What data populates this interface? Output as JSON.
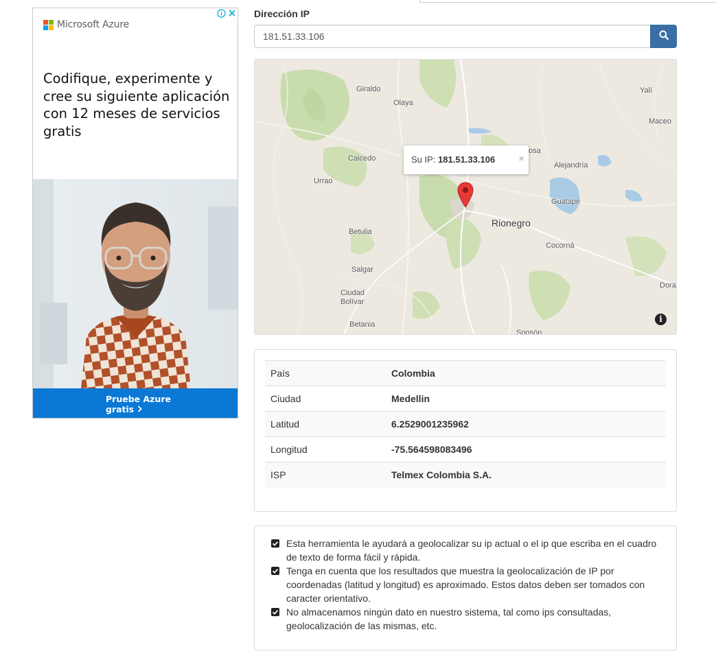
{
  "ad": {
    "brand": "Microsoft Azure",
    "headline": "Codifique, experimente y cree su siguiente aplicación con 12 meses de servicios gratis",
    "cta_line1": "Pruebe Azure",
    "cta_line2": "gratis",
    "info_icon": "info-icon",
    "close_icon": "close-icon",
    "colors": {
      "red": "#f25022",
      "green": "#7fba00",
      "blue": "#00a4ef",
      "yellow": "#ffb900",
      "cta": "#0a78d4"
    }
  },
  "search": {
    "label": "Dirección IP",
    "value": "181.51.33.106",
    "button_icon": "search-icon",
    "button_color": "#3b6ea5"
  },
  "map": {
    "popup_prefix": "Su IP:",
    "popup_ip": "181.51.33.106",
    "popup_close": "×",
    "info_symbol": "i",
    "places": [
      "Giraldo",
      "Olaya",
      "Yalí",
      "Maceo",
      "Caicedo",
      "Urrao",
      "Alejandría",
      "Guatapé",
      "Rionegro",
      "Betulia",
      "Cocorná",
      "Salgar",
      "Ciudad Bolívar",
      "Dora",
      "Betania",
      "Sonsón",
      "osa"
    ]
  },
  "info": {
    "rows": [
      {
        "key": "País",
        "value": "Colombia"
      },
      {
        "key": "Ciudad",
        "value": "Medellin"
      },
      {
        "key": "Latitud",
        "value": "6.2529001235962"
      },
      {
        "key": "Longitud",
        "value": "-75.564598083496"
      },
      {
        "key": "ISP",
        "value": "Telmex Colombia S.A."
      }
    ]
  },
  "notes": [
    "Esta herramienta le ayudará a geolocalizar su ip actual o el ip que escriba en el cuadro de texto de forma fácil y rápida.",
    "Tenga en cuenta que los resultados que muestra la geolocalización de IP por coordenadas (latitud y longitud) es aproximado. Estos datos deben ser tomados con caracter orientativo.",
    "No almacenamos ningún dato en nuestro sistema, tal como ips consultadas, geolocalización de las mismas, etc."
  ]
}
